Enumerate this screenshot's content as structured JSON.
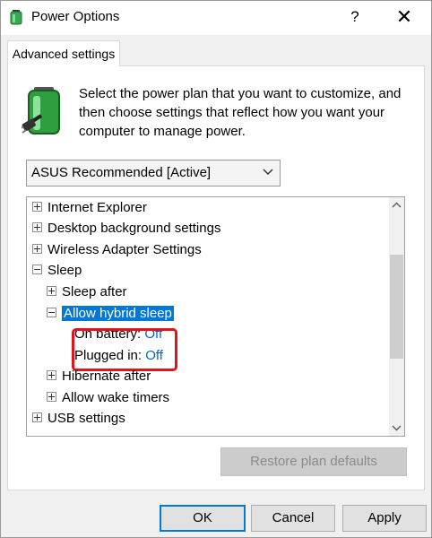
{
  "window": {
    "title": "Power Options",
    "help_label": "?",
    "close_label": "✕",
    "icon": "power-options-icon"
  },
  "tabs": [
    {
      "label": "Advanced settings",
      "active": true
    }
  ],
  "description": "Select the power plan that you want to customize, and then choose settings that reflect how you want your computer to manage power.",
  "plan_select": {
    "value": "ASUS Recommended [Active]"
  },
  "tree": {
    "items": [
      {
        "label": "Internet Explorer",
        "expander": "plus"
      },
      {
        "label": "Desktop background settings",
        "expander": "plus"
      },
      {
        "label": "Wireless Adapter Settings",
        "expander": "plus"
      },
      {
        "label": "Sleep",
        "expander": "minus"
      },
      {
        "label": "Sleep after",
        "expander": "plus"
      },
      {
        "label": "Allow hybrid sleep",
        "expander": "minus",
        "selected": true
      },
      {
        "label": "On battery:",
        "value": "Off"
      },
      {
        "label": "Plugged in:",
        "value": "Off"
      },
      {
        "label": "Hibernate after",
        "expander": "plus"
      },
      {
        "label": "Allow wake timers",
        "expander": "plus"
      },
      {
        "label": "USB settings",
        "expander": "plus"
      }
    ],
    "highlight_color": "#e3121b",
    "selection_color": "#0078d7"
  },
  "buttons": {
    "restore": "Restore plan defaults",
    "ok": "OK",
    "cancel": "Cancel",
    "apply": "Apply"
  }
}
